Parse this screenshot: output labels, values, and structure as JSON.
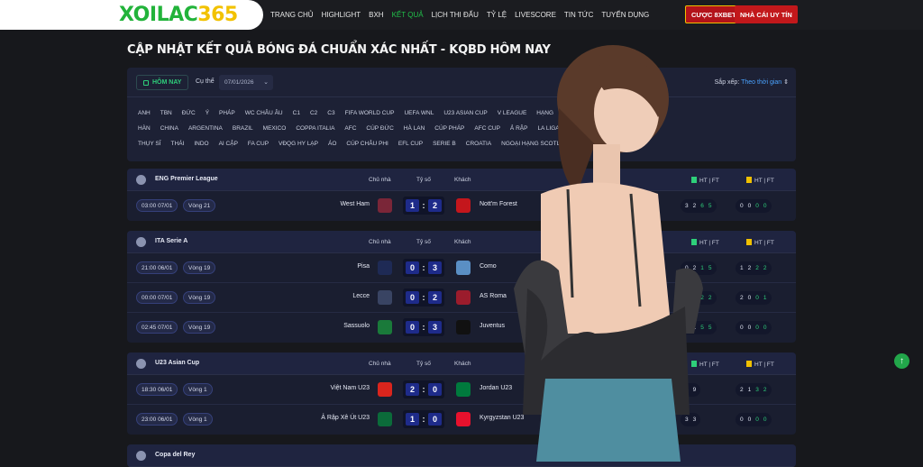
{
  "logo": {
    "text": "XOILAC",
    "number": "365"
  },
  "nav": [
    "TRANG CHỦ",
    "HIGHLIGHT",
    "BXH",
    "KẾT QUẢ",
    "LỊCH THI ĐẤU",
    "TỶ LỆ",
    "LIVESCORE",
    "TIN TỨC",
    "TUYỂN DỤNG"
  ],
  "nav_active": 3,
  "buttons": {
    "promo": "CƯỢC 8XBET",
    "trusted": "NHÀ CÁI UY TÍN"
  },
  "heading": "CẬP NHẬT KẾT QUẢ BÓNG ĐÁ CHUẨN XÁC NHẤT - KQBD HÔM NAY",
  "filter": {
    "today": "HÔM NAY",
    "cuthe": "Cụ thể",
    "date": "07/01/2026",
    "sort_label": "Sắp xếp:",
    "sort_value": "Theo thời gian"
  },
  "league_rows": [
    [
      "ANH",
      "TBN",
      "ĐỨC",
      "Ý",
      "PHÁP",
      "WC CHÂU ÂU",
      "C1",
      "C2",
      "C3",
      "FIFA WORLD CUP",
      "UEFA WNL",
      "U23 ASIAN CUP",
      "V LEAGUE",
      "HẠNG",
      "MLS",
      "NGA",
      "ÚC",
      "NHẬT"
    ],
    [
      "HÀN",
      "CHINA",
      "ARGENTINA",
      "BRAZIL",
      "MEXICO",
      "COPPA ITALIA",
      "AFC",
      "CÚP ĐỨC",
      "HÀ LAN",
      "CÚP PHÁP",
      "AFC CUP",
      "Ả RẬP",
      "LA LIGA",
      "ĐAN MẠCH",
      "BỈ",
      "NA UY"
    ],
    [
      "THỤY SĨ",
      "THÁI",
      "INDO",
      "AI CẬP",
      "FA CUP",
      "VĐQG HY LẠP",
      "ÁO",
      "CÚP CHÂU PHI",
      "EFL CUP",
      "SERIE B",
      "CROATIA",
      "NGOẠI HẠNG SCOTLAND"
    ]
  ],
  "col_labels": {
    "home": "Chủ nhà",
    "score": "Tỷ số",
    "away": "Khách",
    "htft": "HT | FT"
  },
  "blocks": [
    {
      "league": "ENG Premier League",
      "matches": [
        {
          "time": "03:00 07/01",
          "round": "Vòng 21",
          "home": "West Ham",
          "away": "Nott'm Forest",
          "sh": "1",
          "sa": "2",
          "c1": [
            "3",
            "2",
            "6",
            "5"
          ],
          "c2": [
            "0",
            "0",
            "0",
            "0"
          ],
          "home_color": "#7a2638",
          "away_color": "#c4161c"
        }
      ]
    },
    {
      "league": "ITA Serie A",
      "matches": [
        {
          "time": "21:00 06/01",
          "round": "Vòng 19",
          "home": "Pisa",
          "away": "Como",
          "sh": "0",
          "sa": "3",
          "c1": [
            "0",
            "2",
            "1",
            "5"
          ],
          "c2": [
            "1",
            "2",
            "2",
            "2"
          ],
          "home_color": "#1e2a55",
          "away_color": "#5a8fc4"
        },
        {
          "time": "00:00 07/01",
          "round": "Vòng 19",
          "home": "Lecce",
          "away": "AS Roma",
          "sh": "0",
          "sa": "2",
          "c1": [
            "1",
            "1",
            "2",
            "2"
          ],
          "c2": [
            "2",
            "0",
            "0",
            "1"
          ],
          "home_color": "#394463",
          "away_color": "#9b1c2c"
        },
        {
          "time": "02:45 07/01",
          "round": "Vòng 19",
          "home": "Sassuolo",
          "away": "Juventus",
          "sh": "0",
          "sa": "3",
          "c1": [
            "1",
            "1",
            "5",
            "5"
          ],
          "c2": [
            "0",
            "0",
            "0",
            "0"
          ],
          "home_color": "#1a7a3a",
          "away_color": "#111111"
        }
      ]
    },
    {
      "league": "U23 Asian Cup",
      "matches": [
        {
          "time": "18:30 06/01",
          "round": "Vòng 1",
          "home": "Việt Nam U23",
          "away": "Jordan U23",
          "sh": "2",
          "sa": "0",
          "c1": [
            "8",
            "9"
          ],
          "c2": [
            "2",
            "1",
            "3",
            "2"
          ],
          "home_color": "#da251d",
          "away_color": "#007a3d"
        },
        {
          "time": "23:00 06/01",
          "round": "Vòng 1",
          "home": "Ả Rập Xê Út U23",
          "away": "Kyrgyzstan U23",
          "sh": "1",
          "sa": "0",
          "c1": [
            "3",
            "3"
          ],
          "c2": [
            "0",
            "0",
            "0",
            "0"
          ],
          "home_color": "#0b6b3a",
          "away_color": "#e8112d"
        }
      ]
    },
    {
      "league": "Copa del Rey",
      "matches": []
    }
  ],
  "fab_icon": "arrow-up-icon"
}
